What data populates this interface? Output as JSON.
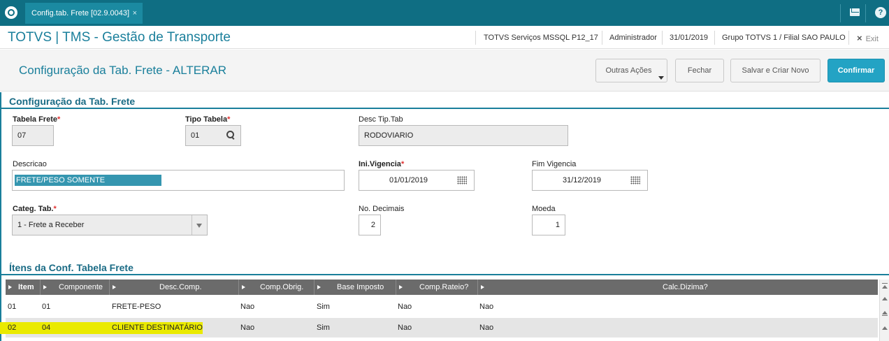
{
  "topbar": {
    "tab_label": "Config.tab. Frete [02.9.0043]",
    "tab_close": "×",
    "help_label": "?",
    "colors": {
      "bar": "#0f6e83",
      "tab": "#1b8aa1"
    }
  },
  "header": {
    "app_title": "TOTVS | TMS - Gestão de Transporte",
    "environment": "TOTVS Serviços MSSQL P12_17",
    "user": "Administrador",
    "date": "31/01/2019",
    "company": "Grupo TOTVS 1 / Filial SAO PAULO",
    "exit_icon": "×",
    "exit_label": "Exit"
  },
  "actionbar": {
    "page_title": "Configuração da Tab. Frete - ALTERAR",
    "other_actions": "Outras Ações",
    "close": "Fechar",
    "save_new": "Salvar e Criar Novo",
    "confirm": "Confirmar",
    "accent": "#23a3c4"
  },
  "form": {
    "section_title": "Configuração da Tab. Frete",
    "tabela_frete": {
      "label": "Tabela Frete",
      "value": "07"
    },
    "tipo_tabela": {
      "label": "Tipo Tabela",
      "value": "01"
    },
    "desc_tip_tab": {
      "label": "Desc Tip.Tab",
      "value": "RODOVIARIO"
    },
    "descricao": {
      "label": "Descricao",
      "value": "FRETE/PESO SOMENTE"
    },
    "ini_vigencia": {
      "label": "Ini.Vigencia",
      "value": "01/01/2019"
    },
    "fim_vigencia": {
      "label": "Fim Vigencia",
      "value": "31/12/2019"
    },
    "categ_tab": {
      "label": "Categ. Tab.",
      "value": "1 - Frete a Receber"
    },
    "no_decimais": {
      "label": "No. Decimais",
      "value": "2"
    },
    "moeda": {
      "label": "Moeda",
      "value": "1"
    },
    "required_mark": "*"
  },
  "grid": {
    "section_title": "Ítens da Conf. Tabela Frete",
    "columns": [
      "Item",
      "Componente",
      "Desc.Comp.",
      "Comp.Obrig.",
      "Base Imposto",
      "Comp.Rateio?",
      "Calc.Dizima?"
    ],
    "rows": [
      {
        "item": "01",
        "componente": "01",
        "desc": "FRETE-PESO",
        "obrig": "Nao",
        "base": "Sim",
        "rateio": "Nao",
        "dizima": "Nao",
        "highlighted": false
      },
      {
        "item": "02",
        "componente": "04",
        "desc": "CLIENTE DESTINATÁRIO",
        "obrig": "Nao",
        "base": "Sim",
        "rateio": "Nao",
        "dizima": "Nao",
        "highlighted": true
      }
    ],
    "highlight_color": "#eaea00"
  }
}
